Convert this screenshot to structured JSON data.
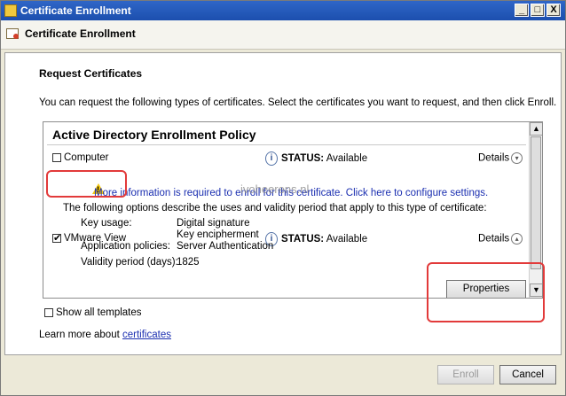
{
  "window": {
    "title": "Certificate Enrollment",
    "minimize": "_",
    "maximize": "□",
    "close": "X"
  },
  "header": {
    "title": "Certificate Enrollment"
  },
  "section": {
    "title": "Request Certificates",
    "description": "You can request the following types of certificates. Select the certificates you want to request, and then click Enroll."
  },
  "policy": {
    "title": "Active Directory Enrollment Policy",
    "items": [
      {
        "label": "Computer",
        "checked": false,
        "status_label": "STATUS:",
        "status_value": "Available",
        "details_label": "Details"
      },
      {
        "label": "VMware View",
        "checked": true,
        "status_label": "STATUS:",
        "status_value": "Available",
        "details_label": "Details"
      }
    ],
    "warning": "More information is required to enroll for this certificate. Click here to configure settings.",
    "options_intro": "The following options describe the uses and validity period that apply to this type of certificate:",
    "key_usage_label": "Key usage:",
    "key_usage_value1": "Digital signature",
    "key_usage_value2": "Key encipherment",
    "app_policies_label": "Application policies:",
    "app_policies_value": "Server Authentication",
    "validity_label": "Validity period (days):",
    "validity_value": "1825",
    "properties_button": "Properties",
    "watermark": "ivoheerens.nl"
  },
  "show_all_templates": "Show all templates",
  "learn_more_prefix": "Learn more about",
  "learn_more_link": "certificates",
  "footer": {
    "enroll": "Enroll",
    "cancel": "Cancel"
  }
}
